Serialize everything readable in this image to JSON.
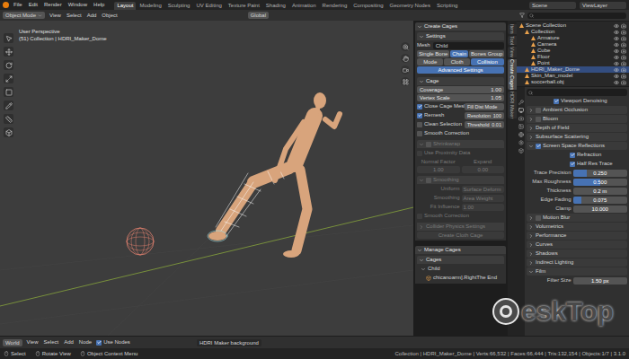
{
  "top_menu": [
    "File",
    "Edit",
    "Render",
    "Window",
    "Help"
  ],
  "workspaces": [
    {
      "label": "Layout",
      "selected": true
    },
    {
      "label": "Modeling",
      "selected": false
    },
    {
      "label": "Sculpting",
      "selected": false
    },
    {
      "label": "UV Editing",
      "selected": false
    },
    {
      "label": "Texture Paint",
      "selected": false
    },
    {
      "label": "Shading",
      "selected": false
    },
    {
      "label": "Animation",
      "selected": false
    },
    {
      "label": "Rendering",
      "selected": false
    },
    {
      "label": "Compositing",
      "selected": false
    },
    {
      "label": "Geometry Nodes",
      "selected": false
    },
    {
      "label": "Scripting",
      "selected": false
    }
  ],
  "scene": "Scene",
  "view_layer": "ViewLayer",
  "viewport_header": {
    "mode": "Object Mode",
    "menus": [
      "View",
      "Select",
      "Add",
      "Object"
    ],
    "orientation": "Global"
  },
  "viewport": {
    "perspective": "User Perspective",
    "collection": "(51) Collection | HDRI_Maker_Dome"
  },
  "sidebar_tabs": [
    {
      "label": "Item",
      "selected": false
    },
    {
      "label": "Tool",
      "selected": false
    },
    {
      "label": "View",
      "selected": false
    },
    {
      "label": "Create Cages",
      "selected": true
    },
    {
      "label": "HDRI Maker",
      "selected": false
    }
  ],
  "create_cages": {
    "title": "Create Cages",
    "settings": "Settings",
    "mesh_label": "Mesh",
    "mesh_value": "Child",
    "mode_row1": [
      {
        "label": "Single Bone",
        "selected": false
      },
      {
        "label": "Chain",
        "selected": true
      },
      {
        "label": "Bones Group",
        "selected": false
      }
    ],
    "mode_row2": [
      {
        "label": "Mode",
        "selected": false
      },
      {
        "label": "Cloth",
        "selected": false
      },
      {
        "label": "Collision",
        "selected": true
      }
    ],
    "advanced": {
      "label": "Advanced Settings",
      "selected": true
    },
    "cage": {
      "title": "Cage",
      "fields": [
        {
          "label": "Coverage",
          "value": "1.00"
        },
        {
          "label": "Vertex Scale",
          "value": "1.05"
        }
      ],
      "options": [
        {
          "label": "Close Cage Mesh",
          "checked": true,
          "side": {
            "label": "Fill Dist Mode",
            "value": ""
          }
        },
        {
          "label": "Remesh",
          "checked": true,
          "side": {
            "label": "Resolution",
            "value": "100"
          }
        },
        {
          "label": "Clean Selection",
          "checked": false,
          "side": {
            "label": "Threshold",
            "value": "0.01"
          }
        },
        {
          "label": "Smooth Correction",
          "checked": false,
          "side": null
        }
      ]
    },
    "shrinkwrap": {
      "title": "Shrinkwrap",
      "checked": false,
      "disabled": true,
      "check_label": "Use Proximity Data",
      "check_checked": false,
      "field_labels": [
        "Normal Factor",
        "Expand"
      ],
      "field_values": [
        "1.00",
        "0.00"
      ]
    },
    "smoothing": {
      "title": "Smoothing",
      "checked": false,
      "disabled": true,
      "pairs": [
        [
          "Uniform",
          "Surface Deform"
        ],
        [
          "Smoothing",
          "Area Weight"
        ],
        [
          "Fit Influence",
          "1.00"
        ]
      ],
      "correction_label": "Smooth Correction",
      "correction_checked": false
    },
    "collider": {
      "title": "Collider Physics Settings",
      "button": "Create Cloth Cage",
      "disabled": true
    },
    "manage": {
      "title": "Manage Cages",
      "list_title": "Cages",
      "group": "Child",
      "items": [
        {
          "label": "chicanoarm].RightThe End",
          "selected": false
        }
      ]
    }
  },
  "outliner": {
    "title": "Scene Collection",
    "collection": "Collection",
    "items": [
      {
        "label": "Armature",
        "selected": false
      },
      {
        "label": "Camera",
        "selected": false
      },
      {
        "label": "Cube",
        "selected": false
      },
      {
        "label": "Floor",
        "selected": false
      },
      {
        "label": "Point",
        "selected": false
      }
    ],
    "root_items": [
      {
        "label": "HDRI_Maker_Dome",
        "selected": true
      },
      {
        "label": "Skin_Man_model",
        "selected": false
      },
      {
        "label": "soccerball.obj",
        "selected": false
      }
    ]
  },
  "properties": {
    "rows": [
      {
        "kind": "check",
        "label": "Viewport Denoising",
        "checked": true
      },
      {
        "kind": "check-section",
        "label": "Ambient Occlusion",
        "checked": false,
        "expanded": false
      },
      {
        "kind": "check-section",
        "label": "Bloom",
        "checked": false,
        "expanded": false
      },
      {
        "kind": "section",
        "label": "Depth of Field",
        "expanded": false
      },
      {
        "kind": "section",
        "label": "Subsurface Scattering",
        "expanded": false
      },
      {
        "kind": "check-section",
        "label": "Screen Space Reflections",
        "checked": true,
        "expanded": true
      },
      {
        "kind": "subcheck",
        "label": "Refraction",
        "checked": true
      },
      {
        "kind": "subcheck",
        "label": "Half Res Trace",
        "checked": true
      },
      {
        "kind": "field",
        "label": "Trace Precision",
        "value": "0.250",
        "level": 0.25
      },
      {
        "kind": "field",
        "label": "Max Roughness",
        "value": "0.500",
        "level": 0.5
      },
      {
        "kind": "field",
        "label": "Thickness",
        "value": "0.2 m",
        "level": 0.0
      },
      {
        "kind": "field",
        "label": "Edge Fading",
        "value": "0.075",
        "level": 0.15
      },
      {
        "kind": "field",
        "label": "Clamp",
        "value": "10.000",
        "level": 0.0
      },
      {
        "kind": "check-section",
        "label": "Motion Blur",
        "checked": false,
        "expanded": false
      },
      {
        "kind": "section",
        "label": "Volumetrics",
        "expanded": false
      },
      {
        "kind": "section",
        "label": "Performance",
        "expanded": false
      },
      {
        "kind": "section",
        "label": "Curves",
        "expanded": false
      },
      {
        "kind": "section",
        "label": "Shadows",
        "expanded": false
      },
      {
        "kind": "section",
        "label": "Indirect Lighting",
        "expanded": false
      },
      {
        "kind": "section",
        "label": "Film",
        "expanded": true
      },
      {
        "kind": "field",
        "label": "Filter Size",
        "value": "1.50 px",
        "level": 0.0
      }
    ]
  },
  "shader_header": {
    "editor": "World",
    "menus": [
      "View",
      "Select",
      "Add",
      "Node"
    ],
    "use_nodes_label": "Use Nodes",
    "use_nodes": true,
    "world": "HDRI Maker background"
  },
  "status_bar": {
    "hints": [
      "Select",
      "Rotate View",
      "Object Context Menu"
    ],
    "stats": "Collection | HDRI_Maker_Dome | Verts:66,532 | Faces:66,444 | Tris:132,154 | Objects:1/7 | 3.1.0"
  },
  "watermark": {
    "text": "eskTop"
  }
}
